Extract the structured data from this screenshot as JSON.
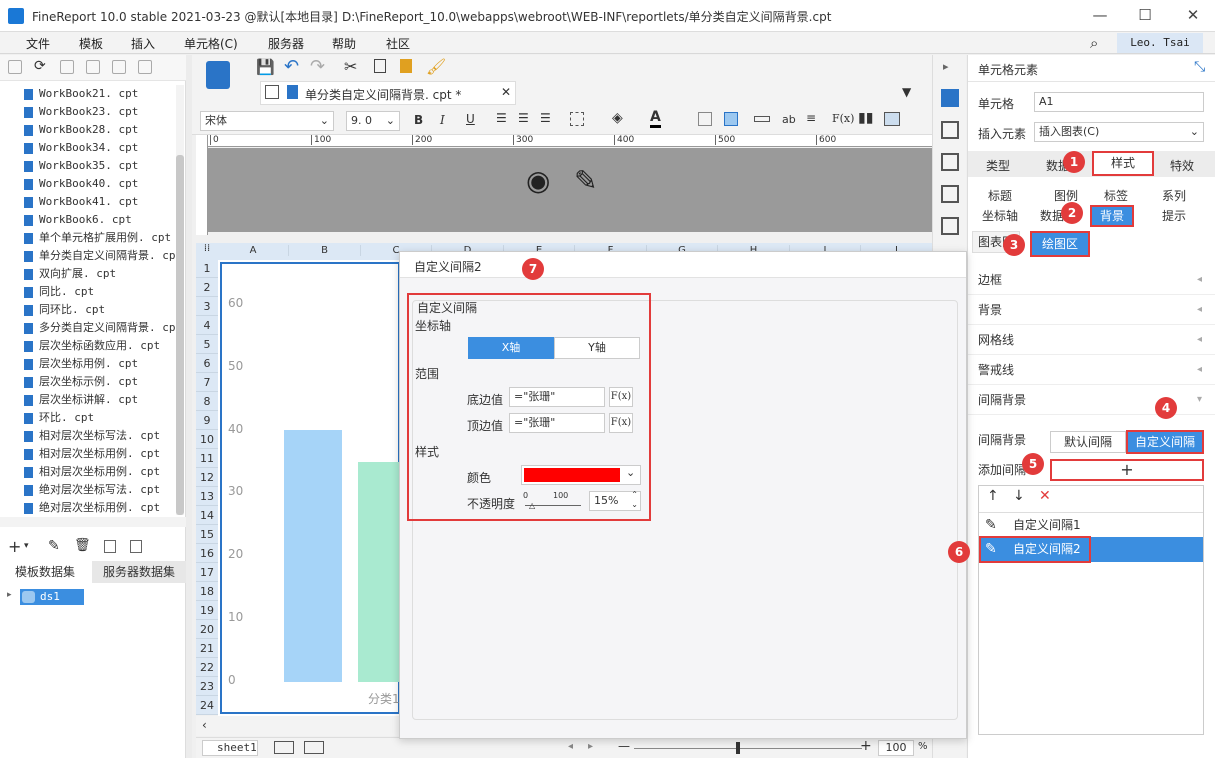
{
  "title": {
    "app": "FineReport 10.0 stable 2021-03-23 @默认[本地目录]",
    "path": "D:\\FineReport_10.0\\webapps\\webroot\\WEB-INF\\reportlets/单分类自定义间隔背景.cpt"
  },
  "menu": [
    "文件",
    "模板",
    "插入",
    "单元格(C)",
    "服务器",
    "帮助",
    "社区"
  ],
  "user": "Leo. Tsai",
  "files": [
    "WorkBook21. cpt",
    "WorkBook23. cpt",
    "WorkBook28. cpt",
    "WorkBook34. cpt",
    "WorkBook35. cpt",
    "WorkBook40. cpt",
    "WorkBook41. cpt",
    "WorkBook6. cpt",
    "单个单元格扩展用例. cpt",
    "单分类自定义间隔背景. cpt",
    "双向扩展. cpt",
    "同比. cpt",
    "同环比. cpt",
    "多分类自定义间隔背景. cpt",
    "层次坐标函数应用. cpt",
    "层次坐标用例. cpt",
    "层次坐标示例. cpt",
    "层次坐标讲解. cpt",
    "环比. cpt",
    "相对层次坐标写法. cpt",
    "相对层次坐标用例. cpt",
    "相对层次坐标用例. cpt",
    "绝对层次坐标写法. cpt",
    "绝对层次坐标用例. cpt"
  ],
  "dataset_tabs": [
    "模板数据集",
    "服务器数据集"
  ],
  "dataset": "ds1",
  "tab": {
    "label": "单分类自定义间隔背景. cpt *"
  },
  "font": {
    "name": "宋体",
    "size": "9. 0"
  },
  "ruler": [
    "0",
    "100",
    "200",
    "300",
    "400",
    "500",
    "600"
  ],
  "columns": [
    "A",
    "B",
    "C",
    "D",
    "E",
    "F",
    "G",
    "H",
    "I",
    "J"
  ],
  "rows": [
    "1",
    "2",
    "3",
    "4",
    "5",
    "6",
    "7",
    "8",
    "9",
    "10",
    "11",
    "12",
    "13",
    "14",
    "15",
    "16",
    "17",
    "18",
    "19",
    "20",
    "21",
    "22",
    "23",
    "24"
  ],
  "chart": {
    "yticks": [
      "60",
      "50",
      "40",
      "30",
      "20",
      "10",
      "0"
    ],
    "xlabel": "分类1"
  },
  "sheet": "sheet1",
  "zoom": "100",
  "zoom_unit": "%",
  "right": {
    "header": "单元格元素",
    "cell_label": "单元格",
    "cell_value": "A1",
    "insert_label": "插入元素",
    "insert_value": "插入图表(C)",
    "tabs": [
      "类型",
      "数据",
      "样式",
      "特效"
    ],
    "subtabs": [
      "标题",
      "图例",
      "标签",
      "系列",
      "坐标轴",
      "数据表",
      "背景",
      "提示"
    ],
    "subtabs2": [
      "图表区",
      "绘图区"
    ],
    "sections": [
      "边框",
      "背景",
      "网格线",
      "警戒线",
      "间隔背景"
    ],
    "interval_label": "间隔背景",
    "interval_default": "默认间隔",
    "interval_custom": "自定义间隔",
    "add_label": "添加间隔",
    "add_btn": "+",
    "list": [
      "自定义间隔1",
      "自定义间隔2"
    ]
  },
  "dialog": {
    "title": "自定义间隔2",
    "group": "自定义间隔",
    "axis_label": "坐标轴",
    "xaxis": "X轴",
    "yaxis": "Y轴",
    "range_label": "范围",
    "bottom_label": "底边值",
    "bottom_value": "=\"张珊\"",
    "top_label": "顶边值",
    "top_value": "=\"张珊\"",
    "fx": "F(x)",
    "style_label": "样式",
    "color_label": "颜色",
    "opacity_label": "不透明度",
    "slider_min": "0",
    "slider_max": "100",
    "opacity_value": "15%"
  },
  "badges": [
    "1",
    "2",
    "3",
    "4",
    "5",
    "6",
    "7"
  ],
  "colors": {
    "accent": "#3b8ee0",
    "red": "#e23b3b",
    "swatch": "#ff0000"
  }
}
